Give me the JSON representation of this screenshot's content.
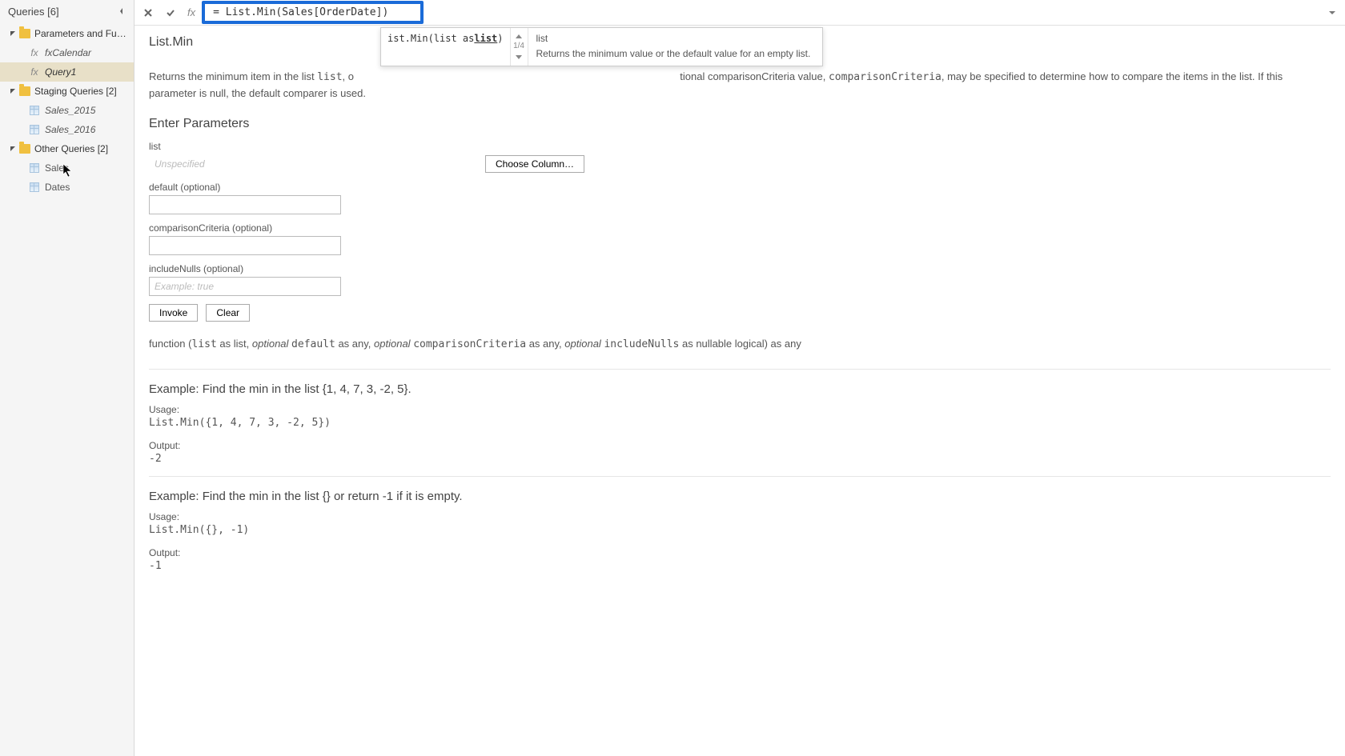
{
  "sidebar": {
    "title": "Queries [6]",
    "groups": [
      {
        "label": "Parameters and Fu…",
        "items": [
          {
            "label": "fxCalendar",
            "icon": "fx",
            "italic": true
          },
          {
            "label": "Query1",
            "icon": "fx",
            "italic": true,
            "selected": true
          }
        ]
      },
      {
        "label": "Staging Queries [2]",
        "items": [
          {
            "label": "Sales_2015",
            "icon": "table",
            "italic": true
          },
          {
            "label": "Sales_2016",
            "icon": "table",
            "italic": true
          }
        ]
      },
      {
        "label": "Other Queries [2]",
        "items": [
          {
            "label": "Sales",
            "icon": "table",
            "italic": false
          },
          {
            "label": "Dates",
            "icon": "table",
            "italic": false
          }
        ]
      }
    ]
  },
  "formulaBar": {
    "fx": "fx",
    "formula": "= List.Min(Sales[OrderDate])"
  },
  "intellisense": {
    "signature_prefix": "ist.Min(list as ",
    "signature_link": "list",
    "signature_suffix": ")",
    "count": "1/4",
    "param": "list",
    "desc": "Returns the minimum value or the default value for an empty list."
  },
  "doc": {
    "title": "List.Min",
    "desc_pre": "Returns the minimum item in the list ",
    "desc_code1": "list",
    "desc_mid1": ", o",
    "desc_mid2": "tional comparisonCriteria value, ",
    "desc_code2": "comparisonCriteria",
    "desc_post": ", may be specified to determine how to compare the items in the list. If this parameter is null, the default comparer is used.",
    "enterParams": "Enter Parameters",
    "params": {
      "list": {
        "label": "list",
        "placeholder": "Unspecified"
      },
      "chooseColumn": "Choose Column…",
      "default": {
        "label": "default (optional)"
      },
      "comparison": {
        "label": "comparisonCriteria (optional)"
      },
      "includeNulls": {
        "label": "includeNulls (optional)",
        "placeholder": "Example: true"
      }
    },
    "invoke": "Invoke",
    "clear": "Clear",
    "signature": {
      "p1": "function (",
      "c1": "list",
      "p2": " as list, ",
      "i1": "optional",
      "p3": " ",
      "c2": "default",
      "p4": " as any, ",
      "i2": "optional",
      "p5": " ",
      "c3": "comparisonCriteria",
      "p6": " as any, ",
      "i3": "optional",
      "p7": " ",
      "c4": "includeNulls",
      "p8": " as nullable logical) as any"
    },
    "ex1": {
      "title": "Example: Find the min in the list {1, 4, 7, 3, -2, 5}.",
      "usageLabel": "Usage:",
      "usage": "List.Min({1, 4, 7, 3, -2, 5})",
      "outputLabel": "Output:",
      "output": "-2"
    },
    "ex2": {
      "title": "Example: Find the min in the list {} or return -1 if it is empty.",
      "usageLabel": "Usage:",
      "usage": "List.Min({}, -1)",
      "outputLabel": "Output:",
      "output": "-1"
    }
  }
}
